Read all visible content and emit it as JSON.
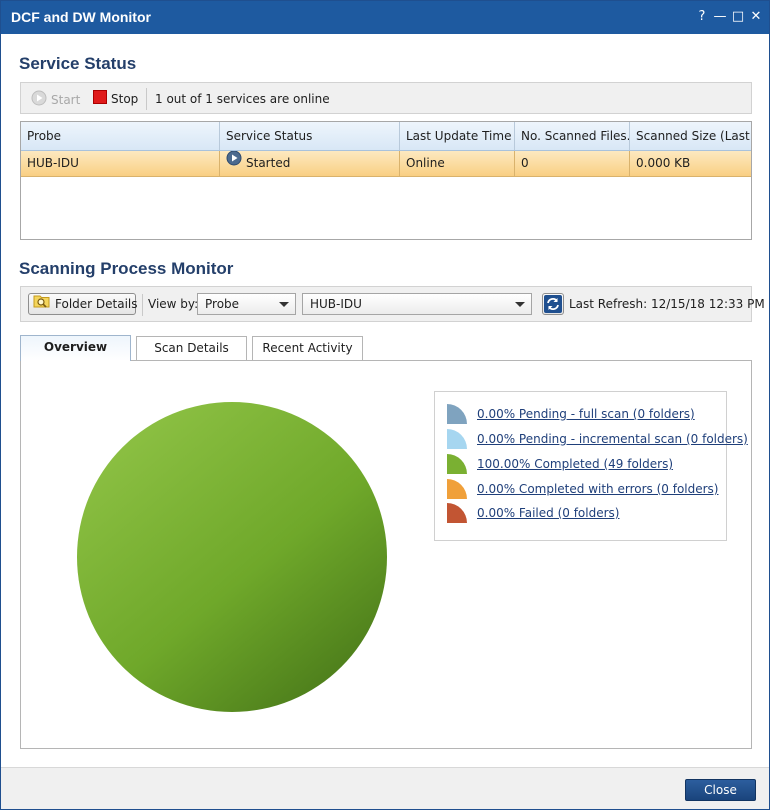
{
  "window": {
    "title": "DCF and DW Monitor",
    "controls": {
      "help": "?",
      "minimize": "—",
      "maximize": "□",
      "close": "✕"
    }
  },
  "service_status": {
    "title": "Service Status",
    "toolbar": {
      "start_label": "Start",
      "stop_label": "Stop",
      "summary": "1 out of 1 services are online"
    },
    "columns": [
      "Probe",
      "Service Status",
      "Last Update Time",
      "No. Scanned Files...",
      "Scanned Size (Last..."
    ],
    "rows": [
      {
        "probe": "HUB-IDU",
        "status": "Started",
        "last_update": "Online",
        "scanned_files": "0",
        "scanned_size": "0.000 KB"
      }
    ]
  },
  "scanning_monitor": {
    "title": "Scanning Process Monitor",
    "folder_details_label": "Folder Details",
    "view_by_label": "View by:",
    "view_by_value": "Probe",
    "probe_value": "HUB-IDU",
    "last_refresh_label": "Last Refresh: 12/15/18 12:33 PM",
    "tabs": [
      {
        "label": "Overview",
        "active": true
      },
      {
        "label": "Scan Details",
        "active": false
      },
      {
        "label": "Recent Activity",
        "active": false
      }
    ],
    "legend": [
      {
        "label": "0.00% Pending - full scan (0 folders)",
        "color": "#7fa3bf"
      },
      {
        "label": "0.00% Pending - incremental scan (0 folders)",
        "color": "#a6d6f0"
      },
      {
        "label": "100.00% Completed (49 folders)",
        "color": "#7ab032"
      },
      {
        "label": "0.00% Completed with errors (0 folders)",
        "color": "#f0a03a"
      },
      {
        "label": "0.00% Failed (0 folders)",
        "color": "#c25533"
      }
    ],
    "pie": {
      "completed_percent": 100,
      "color": "#7ab032"
    }
  },
  "footer": {
    "close_label": "Close"
  },
  "icons": {
    "start": "play-circle-icon",
    "stop": "stop-square-icon",
    "started": "play-circle-icon",
    "folder": "folder-search-icon",
    "refresh": "refresh-icon"
  }
}
